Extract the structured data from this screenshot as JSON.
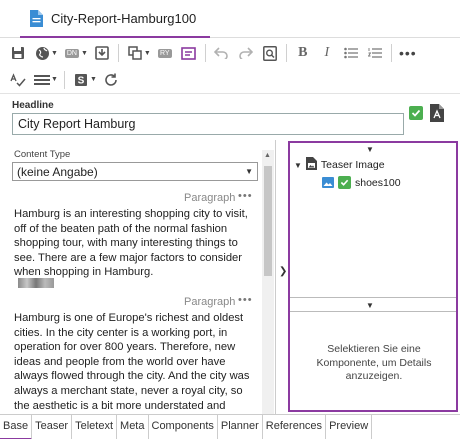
{
  "document": {
    "tab_title": "City-Report-Hamburg100"
  },
  "toolbar": {
    "dn_badge": "DN",
    "ry_badge": "RY",
    "bold": "B",
    "italic": "I"
  },
  "headline": {
    "label": "Headline",
    "value": "City Report Hamburg"
  },
  "editor": {
    "content_type_label": "Content Type",
    "content_type_value": "(keine Angabe)",
    "paragraphs": [
      {
        "label": "Paragraph",
        "text": "Hamburg is an interesting shopping city to visit, off of the beaten path of the normal fashion shopping tour, with many interesting things to see. There are a few major factors to consider when shopping in Hamburg."
      },
      {
        "label": "Paragraph",
        "text": "Hamburg is one of Europe's richest and oldest cities. In the city center is a working port, in operation for over 800 years. Therefore, new ideas and people from the world over have always flowed through the city. And the city was always a merchant state, never a royal city, so the aesthetic is a bit more understated and classic. Due to its proximity to Scandinavia"
      }
    ]
  },
  "panel": {
    "tree_root": "Teaser Image",
    "tree_child": "shoes100",
    "message": "Selektieren Sie eine Komponente, um Details anzuzeigen."
  },
  "tabs": [
    "Base",
    "Teaser",
    "Teletext",
    "Meta",
    "Components",
    "Planner",
    "References",
    "Preview"
  ],
  "colors": {
    "accent": "#8b3aa0",
    "success": "#4caf50",
    "icon_blue": "#3a8dd4"
  }
}
